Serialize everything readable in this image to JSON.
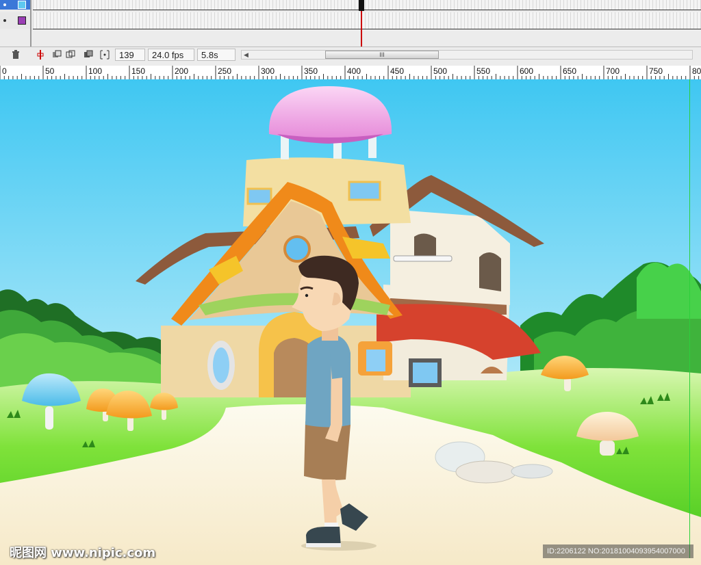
{
  "timeline": {
    "current_frame": "139",
    "fps": "24.0 fps",
    "elapsed_time": "5.8s",
    "scroll_thumb_label": "III",
    "layers": [
      {
        "swatch_color": "#5ec8f0",
        "selected": true
      },
      {
        "swatch_color": "#9b3fb5",
        "selected": false
      }
    ],
    "controls": [
      {
        "icon": "trash-icon",
        "glyph": "🗑"
      },
      {
        "icon": "center-frame-icon",
        "glyph": "⇞"
      },
      {
        "icon": "onion-skin-icon",
        "glyph": "⧉"
      },
      {
        "icon": "onion-skin-outlines-icon",
        "glyph": "⧈"
      },
      {
        "icon": "edit-multiple-frames-icon",
        "glyph": "▣"
      },
      {
        "icon": "modify-onion-markers-icon",
        "glyph": "⟦⟧"
      }
    ]
  },
  "ruler": {
    "labels": [
      "0",
      "50",
      "100",
      "150",
      "200",
      "250",
      "300",
      "350",
      "400",
      "450",
      "500",
      "550",
      "600",
      "650",
      "700",
      "750",
      "80"
    ]
  },
  "stage": {
    "scene": "cartoon-house-boy-walking"
  },
  "watermark": {
    "left_text": "昵图网 www.nipic.com",
    "right_text": "ID:2206122 NO:20181004093954007000"
  }
}
